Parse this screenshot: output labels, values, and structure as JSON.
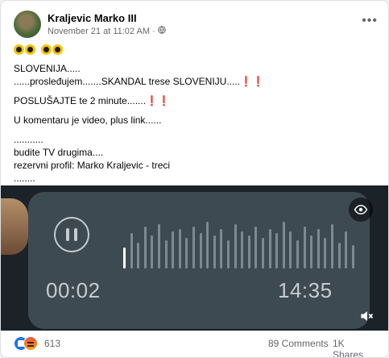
{
  "post": {
    "author": "Kraljevic Marko III",
    "date": "November 21 at 11:02 AM",
    "separator": "·",
    "privacy_icon": "globe-icon",
    "more_icon": "ellipsis-icon",
    "emoji_icon": "radioactive-icon",
    "text_lines": [
      "SLOVENIJA.....",
      "......prosleđujem.......SKANDAL trese SLOVENIJU.....",
      "POSLUŠAJTE te 2 minute.......",
      "U komentaru je video, plus link......",
      "...........",
      "budite TV drugima....",
      "rezervni profil: Marko Kraljevic - treci",
      "........"
    ],
    "exclamation": "❗❗"
  },
  "media": {
    "elapsed": "00:02",
    "duration": "14:35",
    "progress": 0.002,
    "wave_bars": [
      0.45,
      0.75,
      0.55,
      0.9,
      0.7,
      0.95,
      0.6,
      0.8,
      0.85,
      0.65,
      0.9,
      0.75,
      1.0,
      0.7,
      0.85,
      0.6,
      0.95,
      0.8,
      0.7,
      0.9,
      0.65,
      0.85,
      0.75,
      1.0,
      0.8,
      0.6,
      0.9,
      0.7,
      0.85,
      0.65,
      0.95,
      0.55,
      0.8,
      0.5
    ],
    "icons": {
      "eye": "eye-icon",
      "mute": "muted-speaker-icon",
      "pause": "pause-icon"
    }
  },
  "footer": {
    "reactions": [
      "like-icon",
      "angry-icon"
    ],
    "reaction_count": "613",
    "comments": "89 Comments",
    "shares": "1K Shares"
  },
  "colors": {
    "accent": "#1877f2",
    "exclaim": "#e0242f",
    "voice_bubble": "#3e4a52"
  }
}
